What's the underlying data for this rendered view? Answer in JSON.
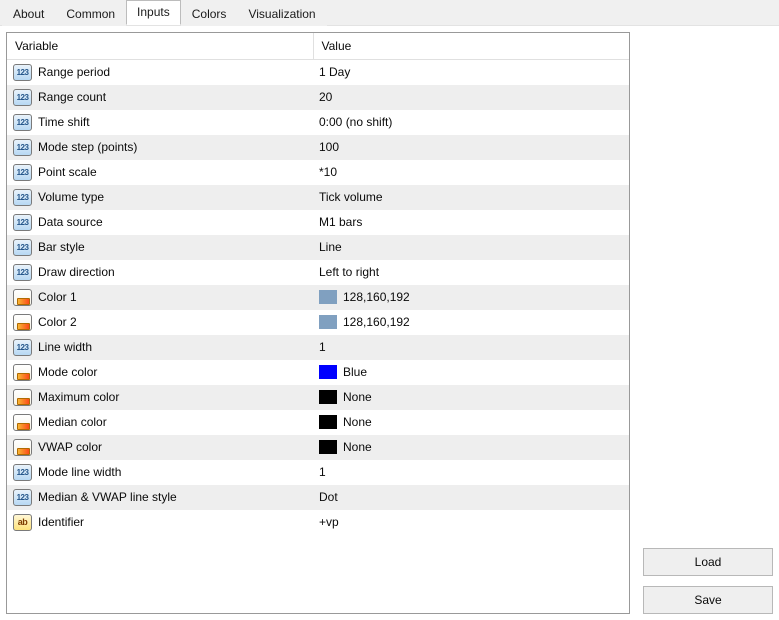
{
  "tabs": [
    "About",
    "Common",
    "Inputs",
    "Colors",
    "Visualization"
  ],
  "active_tab": "Inputs",
  "columns": [
    "Variable",
    "Value"
  ],
  "rows": [
    {
      "icon": "123",
      "name": "Range period",
      "value": "1 Day"
    },
    {
      "icon": "123",
      "name": "Range count",
      "value": "20"
    },
    {
      "icon": "123",
      "name": "Time shift",
      "value": "0:00 (no shift)"
    },
    {
      "icon": "123",
      "name": "Mode step (points)",
      "value": "100"
    },
    {
      "icon": "123",
      "name": "Point scale",
      "value": "*10"
    },
    {
      "icon": "123",
      "name": "Volume type",
      "value": "Tick volume"
    },
    {
      "icon": "123",
      "name": "Data source",
      "value": "M1 bars"
    },
    {
      "icon": "123",
      "name": "Bar style",
      "value": "Line"
    },
    {
      "icon": "123",
      "name": "Draw direction",
      "value": "Left to right"
    },
    {
      "icon": "pal",
      "name": "Color 1",
      "value": "128,160,192",
      "swatch": "#80a0c0"
    },
    {
      "icon": "pal",
      "name": "Color 2",
      "value": "128,160,192",
      "swatch": "#80a0c0"
    },
    {
      "icon": "123",
      "name": "Line width",
      "value": "1"
    },
    {
      "icon": "pal",
      "name": "Mode color",
      "value": "Blue",
      "swatch": "#0000ff"
    },
    {
      "icon": "pal",
      "name": "Maximum color",
      "value": "None",
      "swatch": "#000000"
    },
    {
      "icon": "pal",
      "name": "Median color",
      "value": "None",
      "swatch": "#000000"
    },
    {
      "icon": "pal",
      "name": "VWAP color",
      "value": "None",
      "swatch": "#000000"
    },
    {
      "icon": "123",
      "name": "Mode line width",
      "value": "1"
    },
    {
      "icon": "123",
      "name": "Median & VWAP line style",
      "value": "Dot"
    },
    {
      "icon": "ab",
      "name": "Identifier",
      "value": "+vp"
    }
  ],
  "buttons": {
    "load": "Load",
    "save": "Save"
  }
}
